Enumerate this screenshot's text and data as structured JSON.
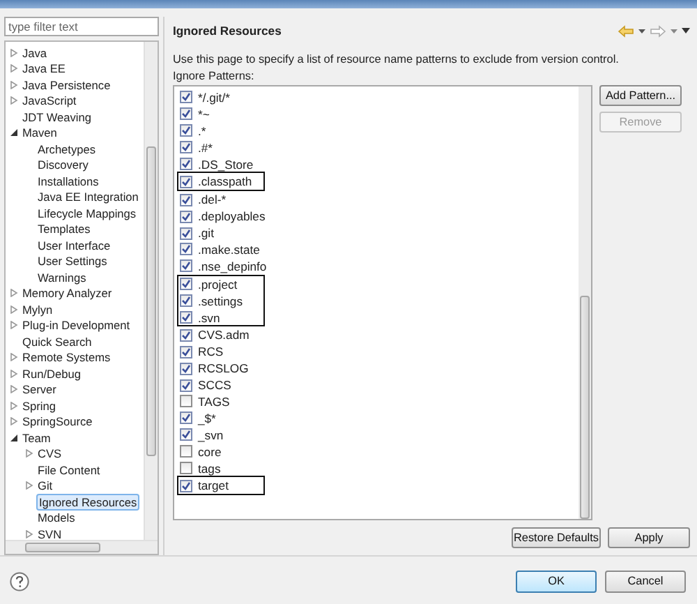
{
  "filter": {
    "placeholder": "type filter text"
  },
  "tree": [
    {
      "label": "Java",
      "expanded": false,
      "selected": false
    },
    {
      "label": "Java EE",
      "expanded": false,
      "selected": false
    },
    {
      "label": "Java Persistence",
      "expanded": false,
      "selected": false
    },
    {
      "label": "JavaScript",
      "expanded": false,
      "selected": false
    },
    {
      "label": "JDT Weaving",
      "selected": false
    },
    {
      "label": "Maven",
      "expanded": true,
      "selected": false,
      "children": [
        {
          "label": "Archetypes",
          "selected": false
        },
        {
          "label": "Discovery",
          "selected": false
        },
        {
          "label": "Installations",
          "selected": false
        },
        {
          "label": "Java EE Integration",
          "selected": false
        },
        {
          "label": "Lifecycle Mappings",
          "selected": false
        },
        {
          "label": "Templates",
          "selected": false
        },
        {
          "label": "User Interface",
          "selected": false
        },
        {
          "label": "User Settings",
          "selected": false
        },
        {
          "label": "Warnings",
          "selected": false
        }
      ]
    },
    {
      "label": "Memory Analyzer",
      "expanded": false,
      "selected": false
    },
    {
      "label": "Mylyn",
      "expanded": false,
      "selected": false
    },
    {
      "label": "Plug-in Development",
      "expanded": false,
      "selected": false
    },
    {
      "label": "Quick Search",
      "selected": false
    },
    {
      "label": "Remote Systems",
      "expanded": false,
      "selected": false
    },
    {
      "label": "Run/Debug",
      "expanded": false,
      "selected": false
    },
    {
      "label": "Server",
      "expanded": false,
      "selected": false
    },
    {
      "label": "Spring",
      "expanded": false,
      "selected": false
    },
    {
      "label": "SpringSource",
      "expanded": false,
      "selected": false
    },
    {
      "label": "Team",
      "expanded": true,
      "selected": false,
      "children": [
        {
          "label": "CVS",
          "expanded": false,
          "selected": false
        },
        {
          "label": "File Content",
          "selected": false
        },
        {
          "label": "Git",
          "expanded": false,
          "selected": false
        },
        {
          "label": "Ignored Resources",
          "selected": true
        },
        {
          "label": "Models",
          "selected": false
        },
        {
          "label": "SVN",
          "expanded": false,
          "selected": false
        }
      ]
    }
  ],
  "page": {
    "title": "Ignored Resources",
    "description": "Use this page to specify a list of resource name patterns to exclude from version control.",
    "list_label": "Ignore Patterns:"
  },
  "patterns": [
    {
      "text": "*/.git/*",
      "checked": true,
      "boxed": false
    },
    {
      "text": "*~",
      "checked": true,
      "boxed": false
    },
    {
      "text": ".*",
      "checked": true,
      "boxed": false
    },
    {
      "text": ".#*",
      "checked": true,
      "boxed": false
    },
    {
      "text": ".DS_Store",
      "checked": true,
      "boxed": false
    },
    {
      "text": ".classpath",
      "checked": true,
      "boxed": true
    },
    {
      "text": ".del-*",
      "checked": true,
      "boxed": false
    },
    {
      "text": ".deployables",
      "checked": true,
      "boxed": false
    },
    {
      "text": ".git",
      "checked": true,
      "boxed": false
    },
    {
      "text": ".make.state",
      "checked": true,
      "boxed": false
    },
    {
      "text": ".nse_depinfo",
      "checked": true,
      "boxed": false
    },
    {
      "text": ".project",
      "checked": true,
      "boxed": true
    },
    {
      "text": ".settings",
      "checked": true,
      "boxed": true
    },
    {
      "text": ".svn",
      "checked": true,
      "boxed": true
    },
    {
      "text": "CVS.adm",
      "checked": true,
      "boxed": false
    },
    {
      "text": "RCS",
      "checked": true,
      "boxed": false
    },
    {
      "text": "RCSLOG",
      "checked": true,
      "boxed": false
    },
    {
      "text": "SCCS",
      "checked": true,
      "boxed": false
    },
    {
      "text": "TAGS",
      "checked": false,
      "boxed": false
    },
    {
      "text": "_$*",
      "checked": true,
      "boxed": false
    },
    {
      "text": "_svn",
      "checked": true,
      "boxed": false
    },
    {
      "text": "core",
      "checked": false,
      "boxed": false
    },
    {
      "text": "tags",
      "checked": false,
      "boxed": false
    },
    {
      "text": "target",
      "checked": true,
      "boxed": true
    }
  ],
  "side_buttons": [
    {
      "label": "Add Pattern...",
      "disabled": false
    },
    {
      "label": "Remove",
      "disabled": true
    }
  ],
  "page_buttons": [
    "Restore Defaults",
    "Apply"
  ],
  "dialog_buttons": [
    {
      "label": "OK",
      "default": true
    },
    {
      "label": "Cancel",
      "default": false
    }
  ]
}
